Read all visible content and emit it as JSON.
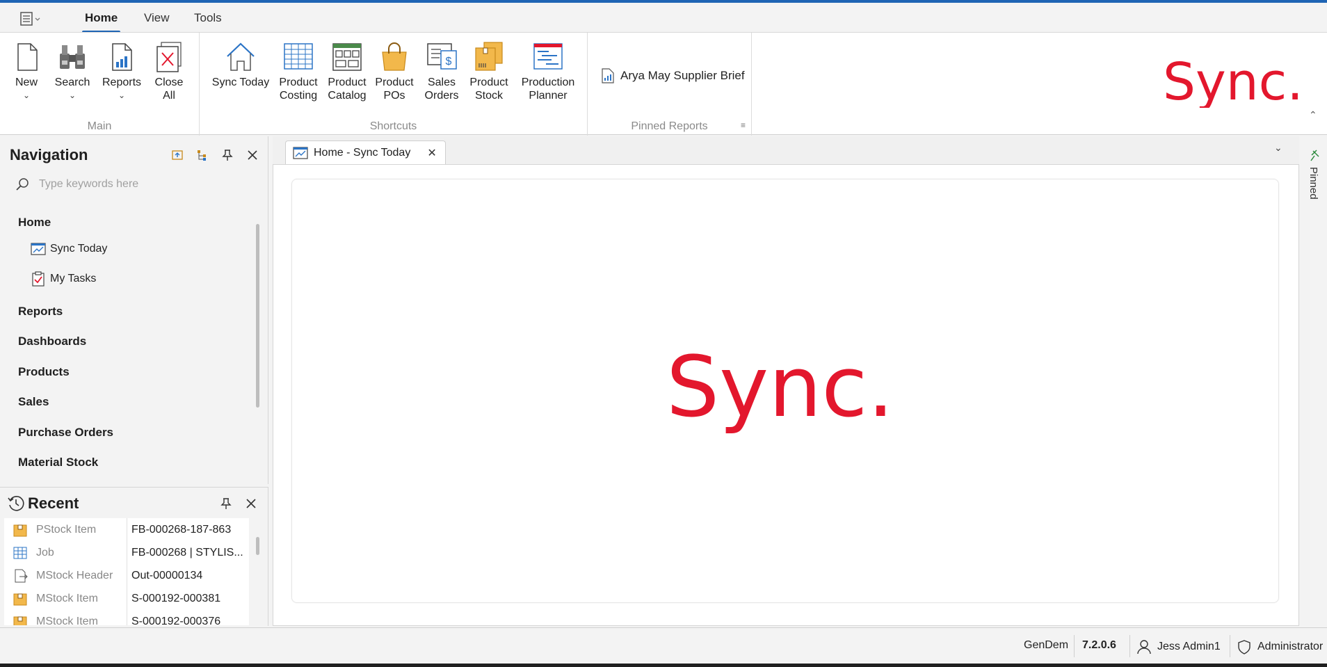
{
  "menu": {
    "tabs": [
      {
        "label": "Home",
        "active": true
      },
      {
        "label": "View",
        "active": false
      },
      {
        "label": "Tools",
        "active": false
      }
    ]
  },
  "ribbon": {
    "main": {
      "label": "Main",
      "new": {
        "line1": "New",
        "icon": "new-document-icon"
      },
      "search": {
        "line1": "Search",
        "icon": "binoculars-icon"
      },
      "reports": {
        "line1": "Reports",
        "icon": "report-chart-icon"
      },
      "close_all": {
        "line1": "Close",
        "line2": "All",
        "icon": "close-all-icon"
      }
    },
    "shortcuts": {
      "label": "Shortcuts",
      "sync_today": {
        "line1": "Sync Today",
        "icon": "home-icon"
      },
      "product_costing": {
        "line1": "Product",
        "line2": "Costing",
        "icon": "spreadsheet-icon"
      },
      "product_catalog": {
        "line1": "Product",
        "line2": "Catalog",
        "icon": "catalog-icon"
      },
      "product_pos": {
        "line1": "Product",
        "line2": "POs",
        "icon": "shopping-bag-icon"
      },
      "sales_orders": {
        "line1": "Sales",
        "line2": "Orders",
        "icon": "sales-order-icon"
      },
      "product_stock": {
        "line1": "Product",
        "line2": "Stock",
        "icon": "stock-boxes-icon"
      },
      "production_planner": {
        "line1": "Production",
        "line2": "Planner",
        "icon": "planner-icon"
      }
    },
    "pinned_reports": {
      "label": "Pinned Reports",
      "items": [
        {
          "label": "Arya May Supplier Brief"
        }
      ]
    },
    "brand": "Sync."
  },
  "navigation": {
    "title": "Navigation",
    "search_placeholder": "Type keywords here",
    "sections": [
      {
        "label": "Home",
        "items": [
          {
            "label": "Sync Today"
          },
          {
            "label": "My Tasks"
          }
        ]
      },
      {
        "label": "Reports"
      },
      {
        "label": "Dashboards"
      },
      {
        "label": "Products"
      },
      {
        "label": "Sales"
      },
      {
        "label": "Purchase Orders"
      },
      {
        "label": "Material Stock"
      }
    ]
  },
  "recent": {
    "title": "Recent",
    "rows": [
      {
        "type": "PStock Item",
        "value": "FB-000268-187-863"
      },
      {
        "type": "Job",
        "value": "FB-000268 | STYLIS..."
      },
      {
        "type": "MStock Header",
        "value": "Out-00000134"
      },
      {
        "type": "MStock Item",
        "value": "S-000192-000381"
      },
      {
        "type": "MStock Item",
        "value": "S-000192-000376"
      }
    ]
  },
  "document": {
    "tab_title": "Home - Sync Today",
    "brand": "Sync."
  },
  "pinned_strip": {
    "label": "Pinned"
  },
  "status": {
    "database": "GenDem",
    "version": "7.2.0.6",
    "user": "Jess Admin1",
    "role": "Administrator"
  },
  "colors": {
    "accent": "#1e64b4",
    "brand_red": "#e3172d"
  }
}
